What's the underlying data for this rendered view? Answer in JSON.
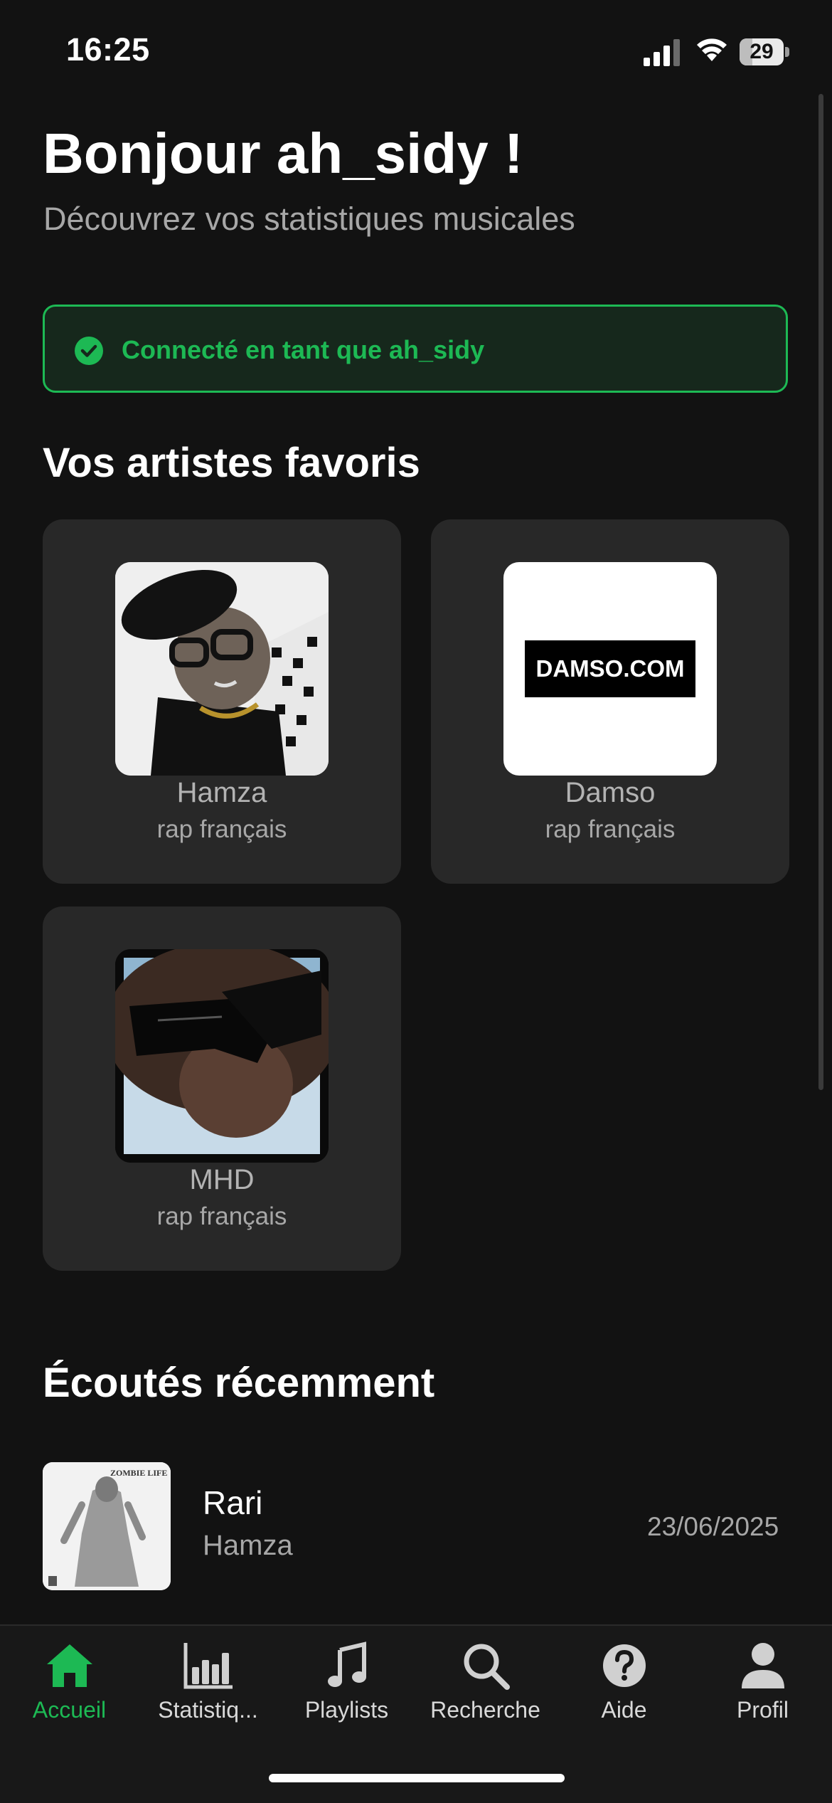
{
  "status_bar": {
    "time": "16:25",
    "battery_percent": 29,
    "battery_level": 0.29
  },
  "header": {
    "title": "Bonjour ah_sidy !",
    "subtitle": "Découvrez vos statistiques musicales"
  },
  "connection_banner": {
    "text": "Connecté en tant que ah_sidy",
    "icon": "check-circle-icon"
  },
  "favorite_artists": {
    "title": "Vos artistes favoris",
    "items": [
      {
        "name": "Hamza",
        "genre": "rap français"
      },
      {
        "name": "Damso",
        "genre": "rap français",
        "image_text": "DAMSO.COM"
      },
      {
        "name": "MHD",
        "genre": "rap français"
      }
    ]
  },
  "recently_played": {
    "title": "Écoutés récemment",
    "items": [
      {
        "title": "Rari",
        "artist": "Hamza",
        "date": "23/06/2025",
        "cover_text": "ZOMBIE LIFE"
      }
    ]
  },
  "tabbar": {
    "tabs": [
      {
        "label": "Accueil",
        "icon": "home-icon",
        "active": true
      },
      {
        "label": "Statistiq...",
        "icon": "bar-chart-icon",
        "active": false
      },
      {
        "label": "Playlists",
        "icon": "music-note-icon",
        "active": false
      },
      {
        "label": "Recherche",
        "icon": "search-icon",
        "active": false
      },
      {
        "label": "Aide",
        "icon": "help-icon",
        "active": false
      },
      {
        "label": "Profil",
        "icon": "user-icon",
        "active": false
      }
    ]
  },
  "colors": {
    "accent": "#1db954",
    "background": "#121212",
    "card": "#282828"
  }
}
